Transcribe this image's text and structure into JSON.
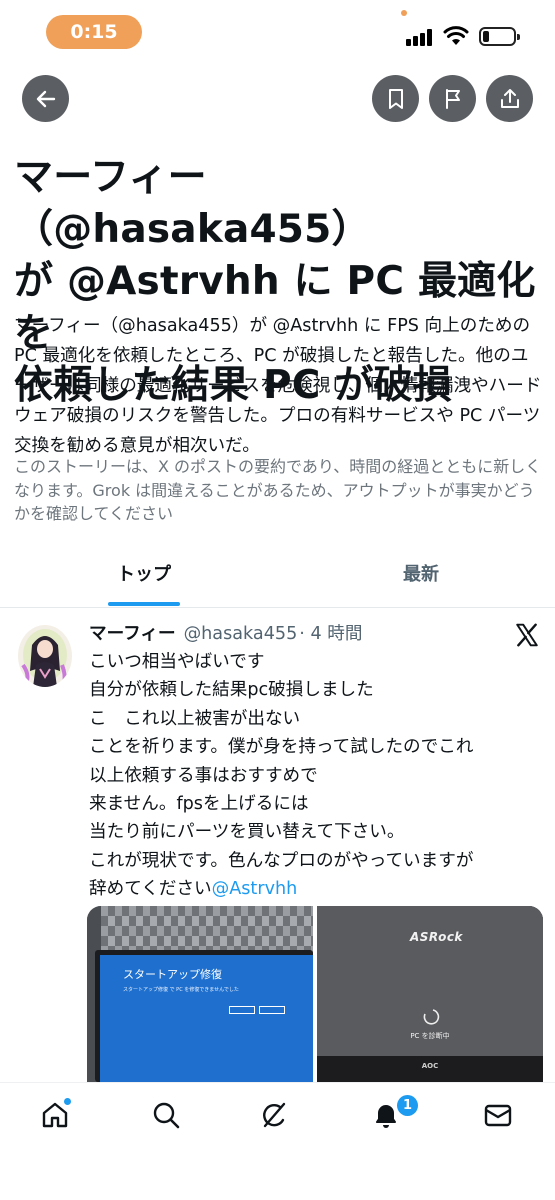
{
  "status_bar": {
    "time": "0:15",
    "battery_level": 0.2
  },
  "toolbar": {
    "back_icon": "arrow-left-icon",
    "bookmark_icon": "bookmark-icon",
    "report_icon": "flag-icon",
    "share_icon": "share-icon"
  },
  "story": {
    "headline_lines": [
      "マーフィー（@hasaka455）",
      "が @Astrvhh に PC 最適化を",
      "依頼した結果 PC が破損"
    ],
    "summary": "マーフィー（@hasaka455）が @Astrvhh に FPS 向上のための PC 最適化を依頼したところ、PC が破損したと報告した。他のユーザーは同様の最適化サービスを危険視し、個人情報漏洩やハードウェア破損のリスクを警告した。プロの有料サービスや PC パーツ交換を勧める意見が相次いだ。",
    "disclaimer": "このストーリーは、X のポストの要約であり、時間の経過とともに新しくなります。Grok は間違えることがあるため、アウトプットが事実かどうかを確認してください"
  },
  "tabs": {
    "top": "トップ",
    "latest": "最新",
    "active": "top"
  },
  "tweet": {
    "display_name": "マーフィー",
    "handle": "@hasaka455",
    "time": "· 4 時間",
    "lines": [
      "こいつ相当やばいです",
      "自分が依頼した結果pc破損しました",
      "こ　これ以上被害が出ない",
      "ことを祈ります。僕が身を持って試したのでこれ",
      "以上依頼する事はおすすめで",
      "来ません。fpsを上げるには",
      "当たり前にパーツを買い替えて下さい。",
      "これが現状です。色んなプロのがやっていますが"
    ],
    "last_line_prefix": "辞めてください",
    "mention": "@Astrvhh",
    "media": {
      "left": {
        "title": "スタートアップ修復",
        "subtitle": "スタートアップ修復 で PC を修復できませんでした"
      },
      "right": {
        "brand": "ASRock",
        "status": "PC を診断中",
        "monitor": "AOC"
      }
    }
  },
  "bottom_nav": {
    "items": [
      "home-icon",
      "search-icon",
      "grok-icon",
      "notifications-icon",
      "messages-icon"
    ],
    "notification_count": "1"
  }
}
